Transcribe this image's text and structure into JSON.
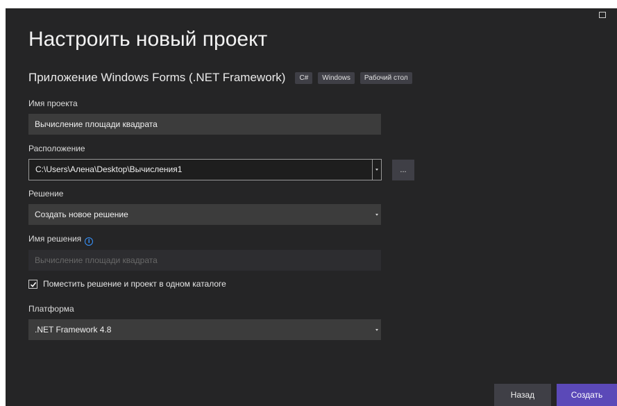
{
  "dialog": {
    "title": "Настроить новый проект",
    "template_name": "Приложение Windows Forms (.NET Framework)",
    "tags": [
      "C#",
      "Windows",
      "Рабочий стол"
    ]
  },
  "project_name": {
    "label": "Имя проекта",
    "value": "Вычисление площади квадрата"
  },
  "location": {
    "label": "Расположение",
    "value": "C:\\Users\\Алена\\Desktop\\Вычисления1",
    "browse_label": "..."
  },
  "solution": {
    "label": "Решение",
    "value": "Создать новое решение"
  },
  "solution_name": {
    "label": "Имя решения",
    "placeholder": "Вычисление площади квадрата",
    "info_icon": "info-icon"
  },
  "same_dir": {
    "label": "Поместить решение и проект в одном каталоге",
    "checked": true
  },
  "platform": {
    "label": "Платформа",
    "value": ".NET Framework 4.8"
  },
  "buttons": {
    "back": "Назад",
    "create": "Создать"
  },
  "colors": {
    "background": "#252526",
    "field": "#3c3c3c",
    "accent": "#5b49b8",
    "info": "#3794ff"
  }
}
